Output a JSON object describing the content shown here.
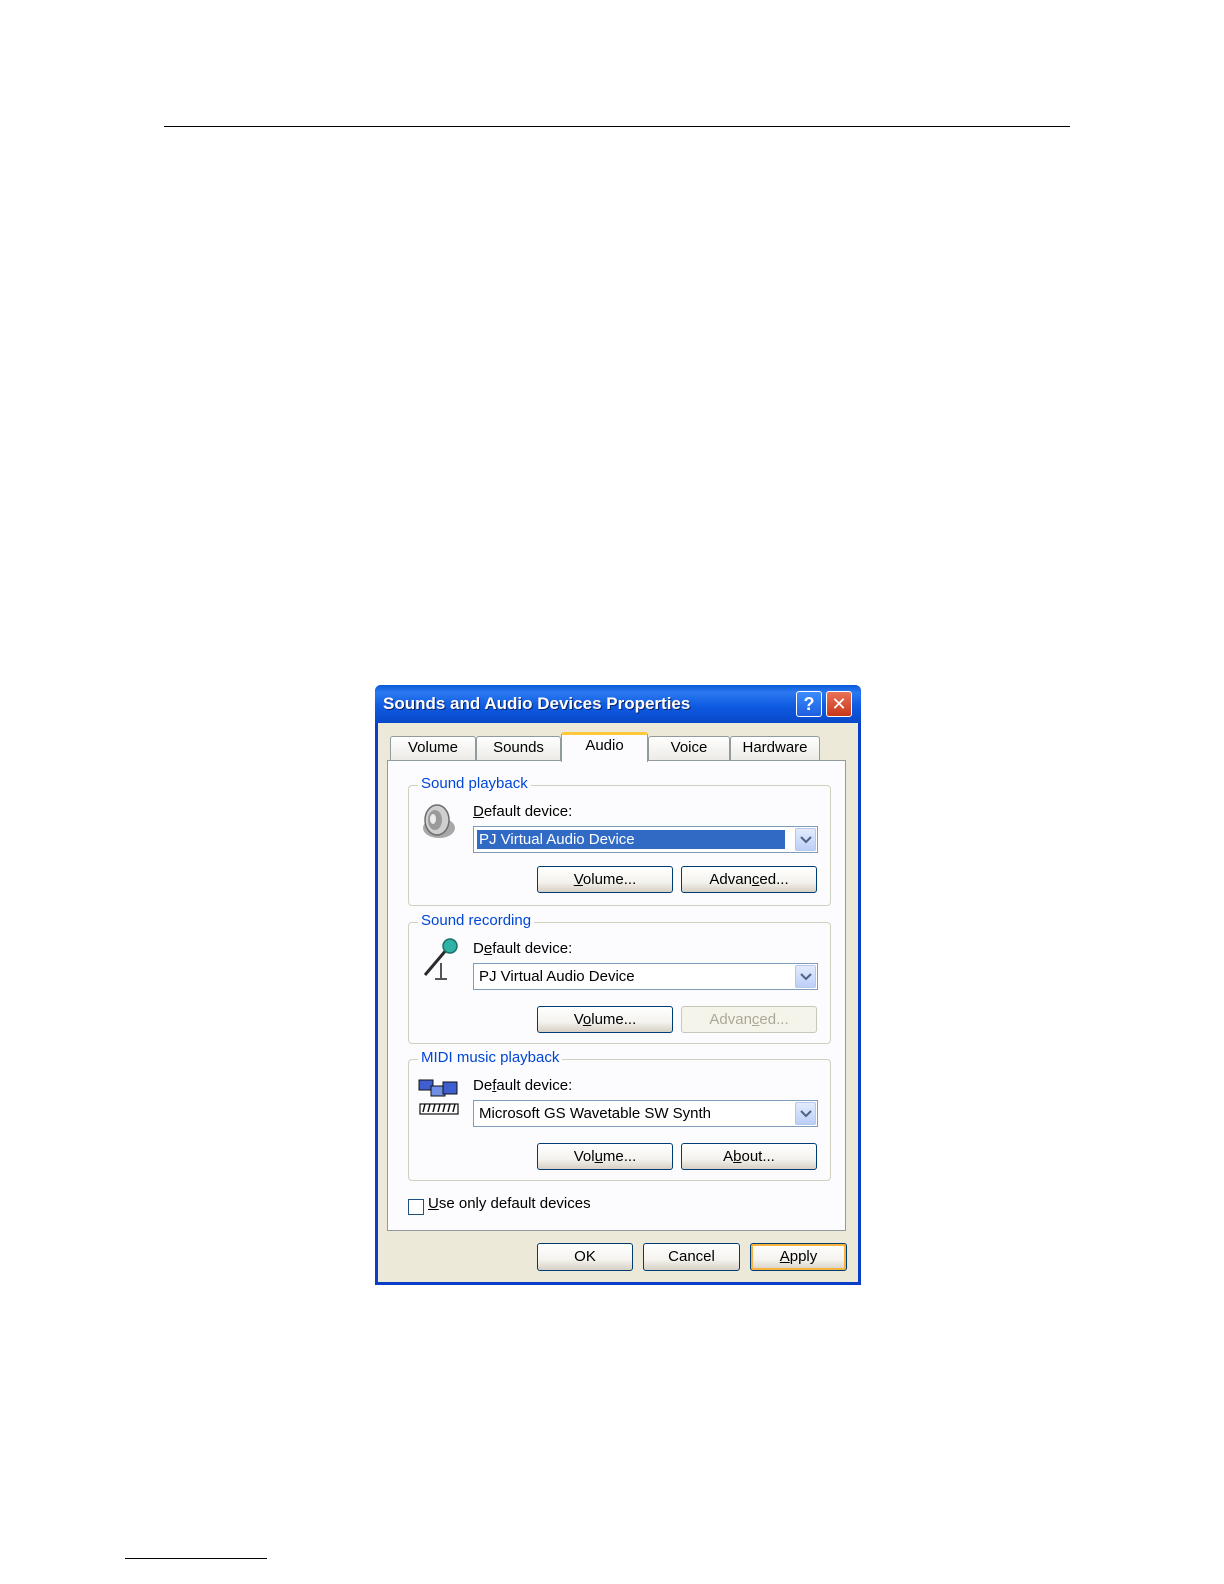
{
  "window": {
    "title": "Sounds and Audio Devices Properties",
    "help_label": "?",
    "close_label": "✕"
  },
  "tabs": [
    {
      "label": "Volume",
      "active": false
    },
    {
      "label": "Sounds",
      "active": false
    },
    {
      "label": "Audio",
      "active": true
    },
    {
      "label": "Voice",
      "active": false
    },
    {
      "label": "Hardware",
      "active": false
    }
  ],
  "sound_playback": {
    "title": "Sound playback",
    "icon": "speaker-icon",
    "default_label_pre": "",
    "default_label_key": "D",
    "default_label_post": "efault device:",
    "device": "PJ Virtual Audio Device",
    "volume_pre": "",
    "volume_key": "V",
    "volume_post": "olume...",
    "advanced_pre": "Advan",
    "advanced_key": "c",
    "advanced_post": "ed..."
  },
  "sound_recording": {
    "title": "Sound recording",
    "icon": "microphone-icon",
    "default_label_pre": "D",
    "default_label_key": "e",
    "default_label_post": "fault device:",
    "device": "PJ Virtual Audio Device",
    "volume_pre": "V",
    "volume_key": "o",
    "volume_post": "lume...",
    "advanced_pre": "Advan",
    "advanced_key": "c",
    "advanced_post": "ed...",
    "advanced_disabled": true
  },
  "midi_playback": {
    "title": "MIDI music playback",
    "icon": "midi-keyboard-icon",
    "default_label_pre": "De",
    "default_label_key": "f",
    "default_label_post": "ault device:",
    "device": "Microsoft GS Wavetable SW Synth",
    "volume_pre": "Vol",
    "volume_key": "u",
    "volume_post": "me...",
    "about_pre": "A",
    "about_key": "b",
    "about_post": "out..."
  },
  "options": {
    "use_default_key": "U",
    "use_default_post": "se only default devices",
    "use_default_checked": false
  },
  "footer": {
    "ok": "OK",
    "cancel": "Cancel",
    "apply_key": "A",
    "apply_post": "pply"
  }
}
